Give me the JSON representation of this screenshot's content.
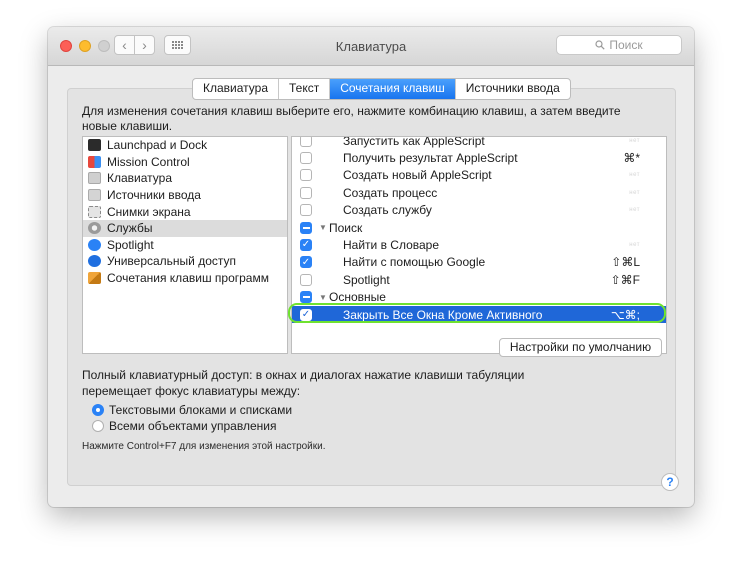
{
  "window": {
    "title": "Клавиатура"
  },
  "toolbar": {
    "back_symbol": "‹",
    "forward_symbol": "›",
    "grid_icon": "grid-icon"
  },
  "search": {
    "placeholder": "Поиск",
    "icon": "magnifier-icon"
  },
  "tabs": [
    {
      "label": "Клавиатура",
      "active": false
    },
    {
      "label": "Текст",
      "active": false
    },
    {
      "label": "Сочетания клавиш",
      "active": true
    },
    {
      "label": "Источники ввода",
      "active": false
    }
  ],
  "instruction": "Для изменения сочетания клавиш выберите его, нажмите комбинацию клавиш, а затем введите новые клавиши.",
  "categories": [
    {
      "label": "Launchpad и Dock",
      "icon": "launchpad-icon",
      "selected": false
    },
    {
      "label": "Mission Control",
      "icon": "mission-control-icon",
      "selected": false
    },
    {
      "label": "Клавиатура",
      "icon": "keyboard-icon",
      "selected": false
    },
    {
      "label": "Источники ввода",
      "icon": "input-sources-icon",
      "selected": false
    },
    {
      "label": "Снимки экрана",
      "icon": "screenshot-icon",
      "selected": false
    },
    {
      "label": "Службы",
      "icon": "services-gear-icon",
      "selected": true
    },
    {
      "label": "Spotlight",
      "icon": "spotlight-icon",
      "selected": false
    },
    {
      "label": "Универсальный доступ",
      "icon": "accessibility-icon",
      "selected": false
    },
    {
      "label": "Сочетания клавиш программ",
      "icon": "app-shortcuts-icon",
      "selected": false
    }
  ],
  "services": [
    {
      "type": "item",
      "label": "Запустить как AppleScript",
      "checked": false,
      "shortcut": "нет"
    },
    {
      "type": "item",
      "label": "Получить результат AppleScript",
      "checked": false,
      "shortcut": "⌘*"
    },
    {
      "type": "item",
      "label": "Создать новый AppleScript",
      "checked": false,
      "shortcut": "нет"
    },
    {
      "type": "item",
      "label": "Создать процесс",
      "checked": false,
      "shortcut": "нет"
    },
    {
      "type": "item",
      "label": "Создать службу",
      "checked": false,
      "shortcut": "нет"
    },
    {
      "type": "group",
      "label": "Поиск",
      "state": "mixed"
    },
    {
      "type": "item",
      "label": "Найти в Словаре",
      "checked": true,
      "shortcut": "нет"
    },
    {
      "type": "item",
      "label": "Найти с помощью Google",
      "checked": true,
      "shortcut": "⇧⌘L"
    },
    {
      "type": "item",
      "label": "Spotlight",
      "checked": false,
      "shortcut": "⇧⌘F"
    },
    {
      "type": "group",
      "label": "Основные",
      "state": "mixed"
    },
    {
      "type": "item",
      "label": "Закрыть Все Окна Кроме Активного",
      "checked": true,
      "shortcut": "⌥⌘;",
      "selected": true
    }
  ],
  "defaults_button": "Настройки по умолчанию",
  "full_keyboard_access": {
    "text": "Полный клавиатурный доступ: в окнах и диалогах нажатие клавиши табуляции перемещает фокус клавиатуры между:",
    "options": [
      {
        "label": "Текстовыми блоками и списками",
        "selected": true
      },
      {
        "label": "Всеми объектами управления",
        "selected": false
      }
    ],
    "hint": "Нажмите Control+F7 для изменения этой настройки."
  },
  "help_symbol": "?",
  "colors": {
    "accent": "#2a82f6",
    "selection": "#1f67d8",
    "highlight_outline": "#6fe22f"
  }
}
